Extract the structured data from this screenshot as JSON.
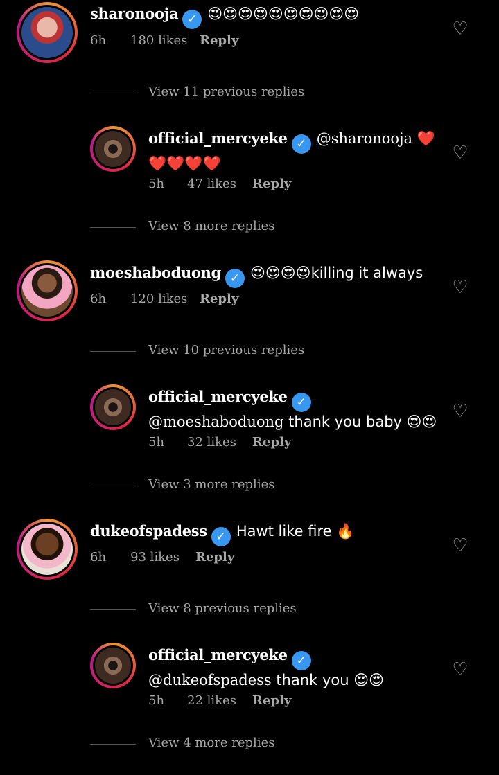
{
  "comments": [
    {
      "username": "sharonooja",
      "text": "😍😍😍😍😍😍😍😍😍😍",
      "time": "6h",
      "likes": "180 likes",
      "reply": "Reply",
      "view_previous": "View 11 previous replies",
      "reply_item": {
        "username": "official_mercyeke",
        "mention": "@sharonooja",
        "text": "❤️❤️❤️❤️❤️",
        "time": "5h",
        "likes": "47 likes",
        "reply": "Reply"
      },
      "view_more": "View 8 more replies"
    },
    {
      "username": "moeshaboduong",
      "text": "😍😍😍😍killing it always",
      "time": "6h",
      "likes": "120 likes",
      "reply": "Reply",
      "view_previous": "View 10 previous replies",
      "reply_item": {
        "username": "official_mercyeke",
        "mention": "@moeshaboduong",
        "text": "thank you baby 😍😍",
        "time": "5h",
        "likes": "32 likes",
        "reply": "Reply"
      },
      "view_more": "View 3 more replies"
    },
    {
      "username": "dukeofspadess",
      "text": "Hawt like fire 🔥",
      "time": "6h",
      "likes": "93 likes",
      "reply": "Reply",
      "view_previous": "View 8 previous replies",
      "reply_item": {
        "username": "official_mercyeke",
        "mention": "@dukeofspadess",
        "text": "thank you 😍😍",
        "time": "5h",
        "likes": "22 likes",
        "reply": "Reply"
      },
      "view_more": "View 4 more replies"
    }
  ],
  "icons": {
    "heart": "heart-outline-icon",
    "verified": "verified-badge-icon"
  },
  "colors": {
    "background": "#000000",
    "text": "#ffffff",
    "muted": "#a8a8a8",
    "verified": "#3897f0"
  }
}
